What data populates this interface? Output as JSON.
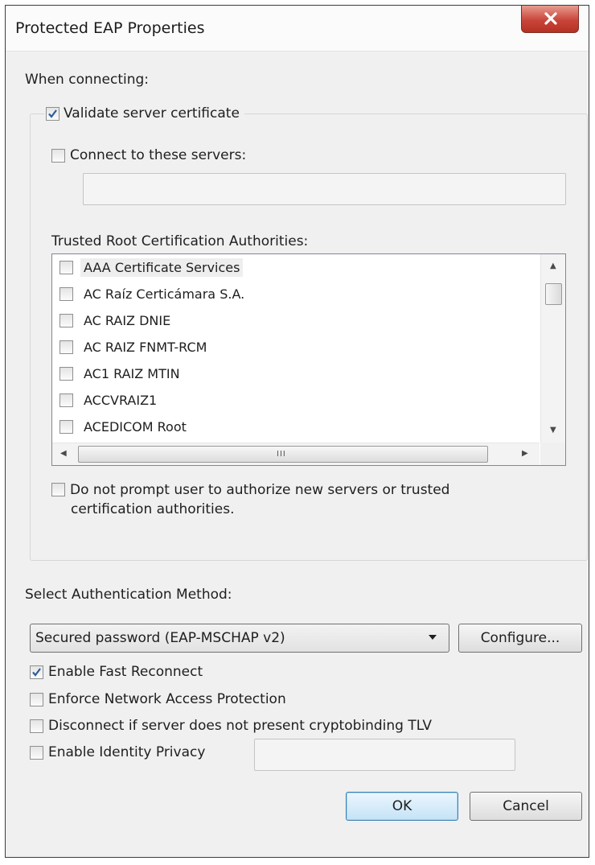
{
  "window": {
    "title": "Protected EAP Properties"
  },
  "when_connecting_label": "When connecting:",
  "validate_server_certificate": {
    "label": "Validate server certificate",
    "checked": true
  },
  "connect_to_servers": {
    "label": "Connect to these servers:",
    "checked": false,
    "value": ""
  },
  "trusted_root_label": "Trusted Root Certification Authorities:",
  "trusted_roots": [
    {
      "label": "AAA Certificate Services",
      "checked": false
    },
    {
      "label": "AC Raíz Certicámara S.A.",
      "checked": false
    },
    {
      "label": "AC RAIZ DNIE",
      "checked": false
    },
    {
      "label": "AC RAIZ FNMT-RCM",
      "checked": false
    },
    {
      "label": "AC1 RAIZ MTIN",
      "checked": false
    },
    {
      "label": "ACCVRAIZ1",
      "checked": false
    },
    {
      "label": "ACEDICOM Root",
      "checked": false
    }
  ],
  "do_not_prompt": {
    "line1": "Do not prompt user to authorize new servers or trusted",
    "line2": "certification authorities.",
    "checked": false
  },
  "auth_method_label": "Select Authentication Method:",
  "auth_method_selected": "Secured password (EAP-MSCHAP v2)",
  "configure_button": "Configure...",
  "options": {
    "fast_reconnect": {
      "label": "Enable Fast Reconnect",
      "checked": true
    },
    "enforce_nap": {
      "label": "Enforce Network Access Protection",
      "checked": false
    },
    "disconnect_tlv": {
      "label": "Disconnect if server does not present cryptobinding TLV",
      "checked": false
    },
    "identity_privacy": {
      "label": "Enable Identity Privacy",
      "checked": false,
      "value": ""
    }
  },
  "ok_button": "OK",
  "cancel_button": "Cancel",
  "scroll_grip": "III"
}
